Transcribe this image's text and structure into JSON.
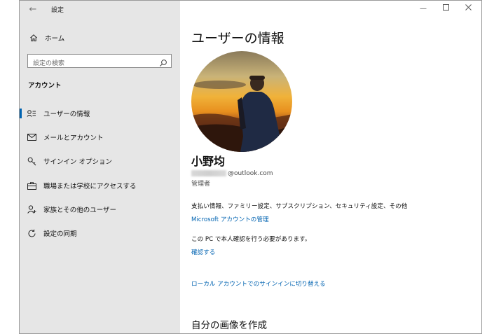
{
  "window": {
    "title": "設定",
    "controls": [
      "minimize-icon",
      "maximize-icon",
      "close-icon"
    ]
  },
  "sidebar": {
    "home_label": "ホーム",
    "search_placeholder": "設定の検索",
    "section_heading": "アカウント",
    "items": [
      {
        "label": "ユーザーの情報",
        "icon": "user-info-icon",
        "active": true
      },
      {
        "label": "メールとアカウント",
        "icon": "mail-icon",
        "active": false
      },
      {
        "label": "サインイン オプション",
        "icon": "key-icon",
        "active": false
      },
      {
        "label": "職場または学校にアクセスする",
        "icon": "briefcase-icon",
        "active": false
      },
      {
        "label": "家族とその他のユーザー",
        "icon": "person-add-icon",
        "active": false
      },
      {
        "label": "設定の同期",
        "icon": "sync-icon",
        "active": false
      }
    ]
  },
  "main": {
    "page_title": "ユーザーの情報",
    "user_name": "小野均",
    "email_domain": "@outlook.com",
    "role": "管理者",
    "billing_info": "支払い情報、ファミリー設定、サブスクリプション、セキュリティ設定、その他",
    "manage_link": "Microsoft アカウントの管理",
    "verify_info": "この PC で本人確認を行う必要があります。",
    "verify_link": "確認する",
    "local_link": "ローカル アカウントでのサインインに切り替える",
    "create_picture_title": "自分の画像を作成"
  },
  "colors": {
    "accent": "#0063b1",
    "sidebar_bg": "#e6e6e6"
  }
}
